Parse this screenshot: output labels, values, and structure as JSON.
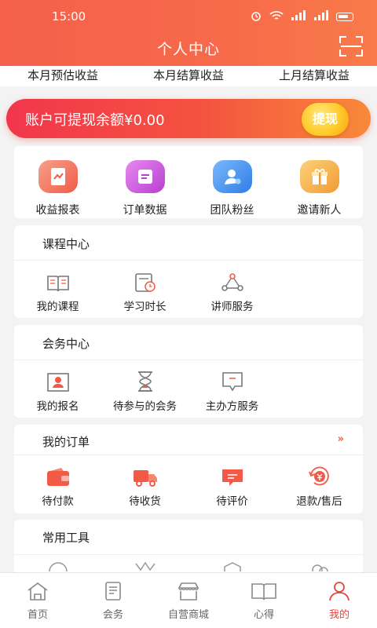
{
  "status": {
    "time": "15:00"
  },
  "header": {
    "title": "个人中心",
    "scan_icon": "scan-icon"
  },
  "earnings_tabs": [
    "本月预估收益",
    "本月结算收益",
    "上月结算收益"
  ],
  "balance": {
    "label": "账户可提现余额¥0.00",
    "withdraw_label": "提现"
  },
  "quick_actions": [
    {
      "label": "收益报表",
      "icon": "report-icon",
      "color": "#f26a54"
    },
    {
      "label": "订单数据",
      "icon": "order-data-icon",
      "color": "#c94fd8"
    },
    {
      "label": "团队粉丝",
      "icon": "team-icon",
      "color": "#3b8cf0"
    },
    {
      "label": "邀请新人",
      "icon": "gift-icon",
      "color": "#f5a742"
    }
  ],
  "course_center": {
    "title": "课程中心",
    "items": [
      {
        "label": "我的课程",
        "icon": "book-icon"
      },
      {
        "label": "学习时长",
        "icon": "study-time-icon"
      },
      {
        "label": "讲师服务",
        "icon": "network-icon"
      }
    ]
  },
  "meeting_center": {
    "title": "会务中心",
    "items": [
      {
        "label": "我的报名",
        "icon": "profile-card-icon"
      },
      {
        "label": "待参与的会务",
        "icon": "hourglass-icon"
      },
      {
        "label": "主办方服务",
        "icon": "message-icon"
      }
    ]
  },
  "my_orders": {
    "title": "我的订单",
    "more": "»",
    "items": [
      {
        "label": "待付款",
        "icon": "wallet-icon"
      },
      {
        "label": "待收货",
        "icon": "truck-icon"
      },
      {
        "label": "待评价",
        "icon": "comment-icon"
      },
      {
        "label": "退款/售后",
        "icon": "refund-icon"
      }
    ]
  },
  "tools": {
    "title": "常用工具"
  },
  "tabbar": [
    {
      "label": "首页",
      "icon": "home-icon",
      "active": false
    },
    {
      "label": "会务",
      "icon": "document-icon",
      "active": false
    },
    {
      "label": "自营商城",
      "icon": "store-icon",
      "active": false
    },
    {
      "label": "心得",
      "icon": "open-book-icon",
      "active": false
    },
    {
      "label": "我的",
      "icon": "person-icon",
      "active": true
    }
  ],
  "colors": {
    "accent": "#f25a46",
    "active_tab": "#e8443c",
    "withdraw": "#ffcb2a"
  }
}
